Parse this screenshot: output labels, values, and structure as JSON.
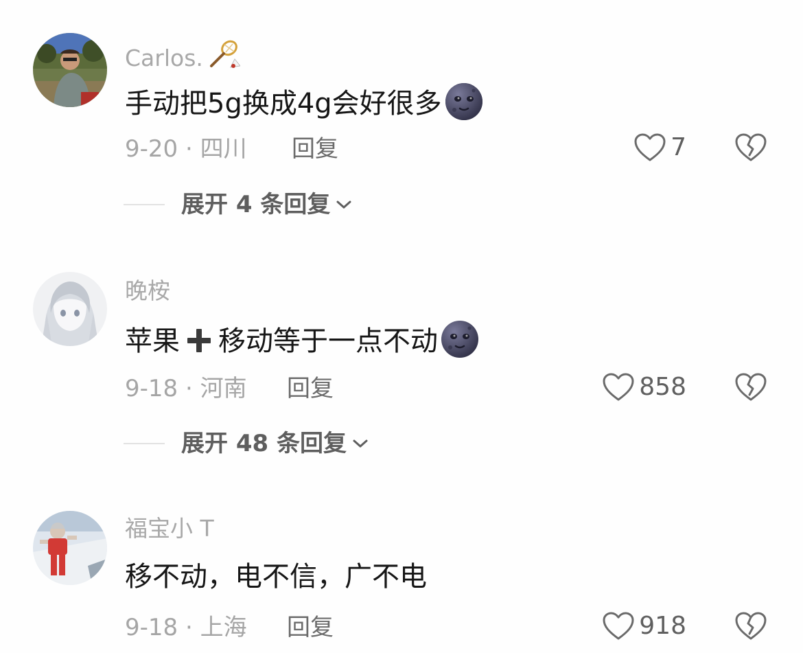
{
  "comments": [
    {
      "username": "Carlos.",
      "username_badge": "badminton-icon",
      "text": "手动把5g换成4g会好很多",
      "text_emoji": "dark-moon-face-icon",
      "date_location": "9-20 · 四川",
      "reply_label": "回复",
      "likes": "7",
      "expand_label": "展开 4 条回复"
    },
    {
      "username": "晚桉",
      "text_part1": "苹果",
      "text_plus": "heavy-plus-icon",
      "text_part2": "移动等于一点不动",
      "text_emoji": "dark-moon-face-icon",
      "date_location": "9-18 · 河南",
      "reply_label": "回复",
      "likes": "858",
      "expand_label": "展开 48 条回复"
    },
    {
      "username": "福宝小 T",
      "text": "移不动，电不信，广不电",
      "date_location": "9-18 · 上海",
      "reply_label": "回复",
      "likes": "918"
    }
  ],
  "colors": {
    "username": "#a8a8a8",
    "text": "#161616",
    "meta": "#a5a5a5",
    "reply": "#6b6b6b",
    "icon": "#6a6a6a"
  }
}
